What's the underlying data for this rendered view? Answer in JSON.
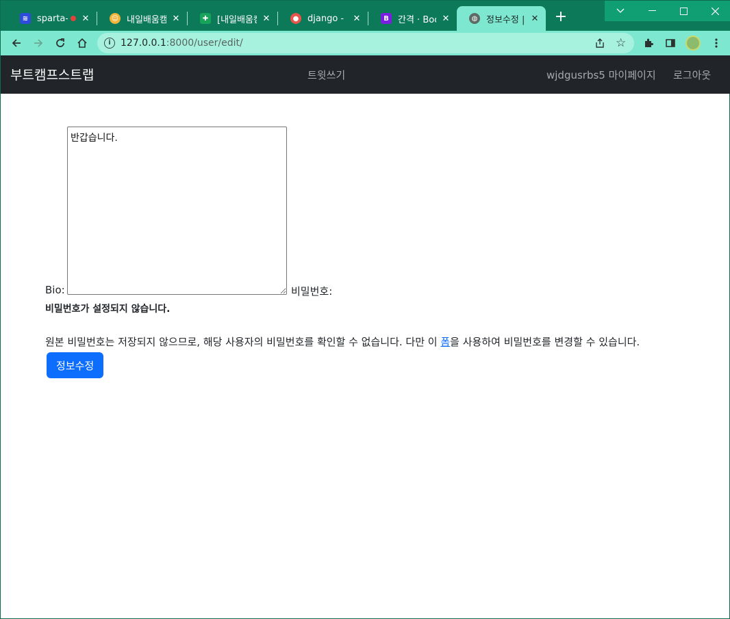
{
  "browser": {
    "tabs": [
      {
        "label": "sparta-m",
        "favicon": "sparta-icon",
        "color": "#2f4bd9"
      },
      {
        "label": "내일배움캠프",
        "favicon": "smiley-icon",
        "color": "#f2b33a"
      },
      {
        "label": "[내일배움캠",
        "favicon": "green-sheet-icon",
        "color": "#18a35a"
      },
      {
        "label": "django - url",
        "favicon": "django-icon",
        "color": "#e8554a"
      },
      {
        "label": "간격 · Bootst",
        "favicon": "bootstrap-icon",
        "color": "#7a1fe0"
      },
      {
        "label": "정보수정 | b",
        "favicon": "globe-icon",
        "color": "#5d6b66",
        "active": true
      }
    ],
    "url_host": "127.0.0.1",
    "url_path": ":8000/user/edit/"
  },
  "navbar": {
    "brand": "부트캠프스트랩",
    "center_link": "트윗쓰기",
    "username_link": "wjdgusrbs5 마이페이지",
    "logout_link": "로그아웃"
  },
  "form": {
    "bio_label": "Bio:",
    "bio_value": "반갑습니다.",
    "password_label": "비밀번호:",
    "password_status": "비밀번호가 설정되지 않습니다.",
    "help_text_before": "원본 비밀번호는 저장되지 않으므로, 해당 사용자의 비밀번호를 확인할 수 없습니다. 다만 이 ",
    "help_link": "폼",
    "help_text_after": "을 사용하여 비밀번호를 변경할 수 있습니다. ",
    "submit_label": "정보수정"
  }
}
